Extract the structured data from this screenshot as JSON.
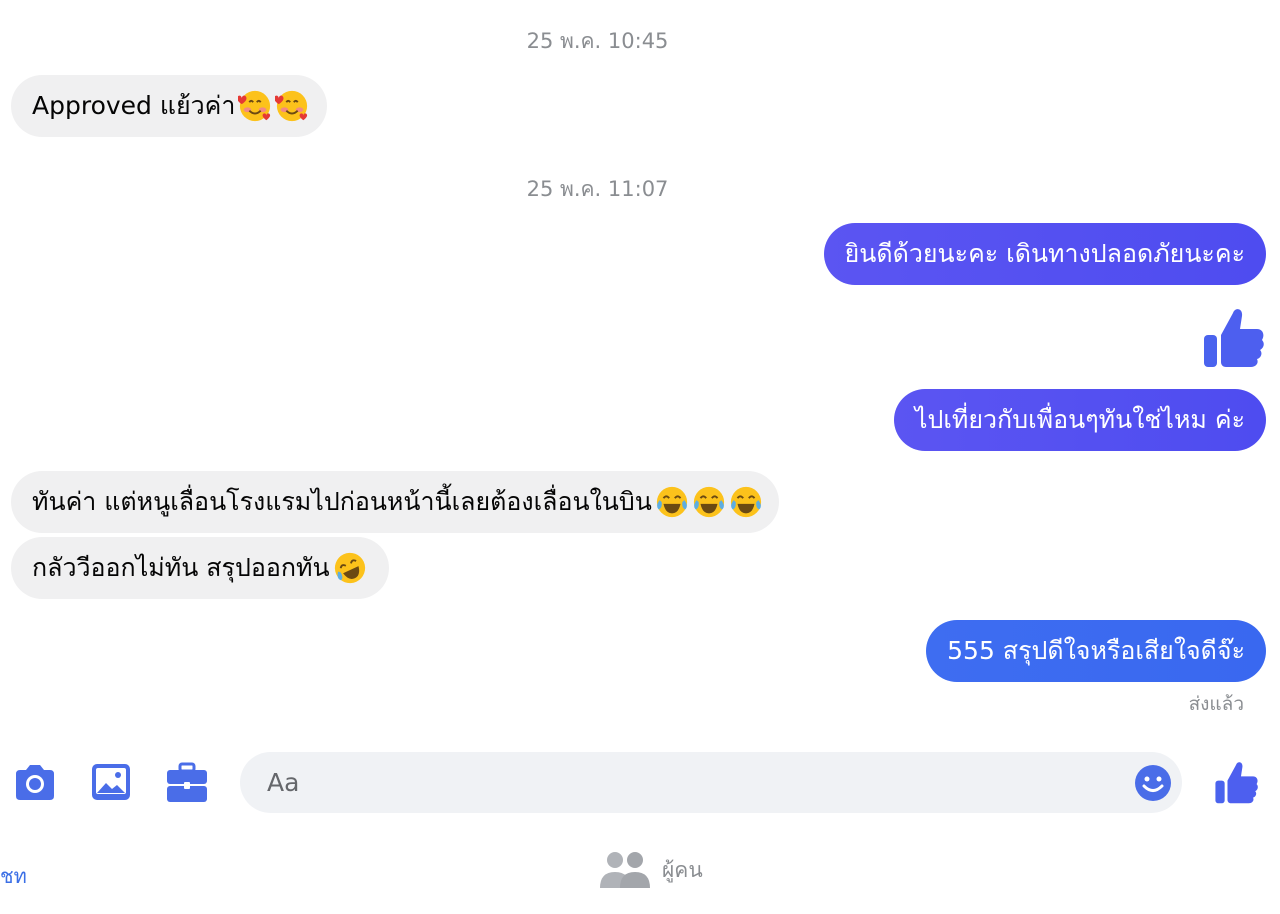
{
  "colors": {
    "accent": "#4b5ae8",
    "incoming_bubble": "#f0f0f1",
    "outgoing_bubble": "#5251f1",
    "outgoing_bubble_last": "#3d6cf1",
    "muted_text": "#8a8d91"
  },
  "conversation": {
    "timestamps": [
      "25 พ.ค. 10:45",
      "25 พ.ค. 11:07"
    ],
    "messages": [
      {
        "sender": "other",
        "text": "Approved แย้วค่า",
        "emoji": [
          "smiling-face-with-hearts",
          "smiling-face-with-hearts"
        ]
      },
      {
        "sender": "me",
        "text": "ยินดีด้วยนะคะ เดินทางปลอดภัยนะคะ"
      },
      {
        "sender": "me",
        "sticker": "thumbs-up"
      },
      {
        "sender": "me",
        "text": "ไปเที่ยวกับเพื่อนๆทันใช่ไหม ค่ะ"
      },
      {
        "sender": "other",
        "text": "ทันค่า แต่หนูเลื่อนโรงแรมไปก่อนหน้านี้เลยต้องเลื่อนในบิน",
        "emoji": [
          "face-with-tears-of-joy",
          "face-with-tears-of-joy",
          "face-with-tears-of-joy"
        ]
      },
      {
        "sender": "other",
        "text": "กลัววีออกไม่ทัน สรุปออกทัน",
        "emoji": [
          "rolling-on-the-floor-laughing"
        ]
      },
      {
        "sender": "me",
        "text": "555 สรุปดีใจหรือเสียใจดีจ๊ะ"
      }
    ],
    "status": "ส่งแล้ว"
  },
  "composer": {
    "placeholder": "Aa",
    "icons": [
      "camera-icon",
      "image-icon",
      "briefcase-icon",
      "smiley-icon",
      "thumbs-up-icon"
    ]
  },
  "bottom_tabs": {
    "chats_label_partial": "ชท",
    "people_label": "ผู้คน"
  }
}
